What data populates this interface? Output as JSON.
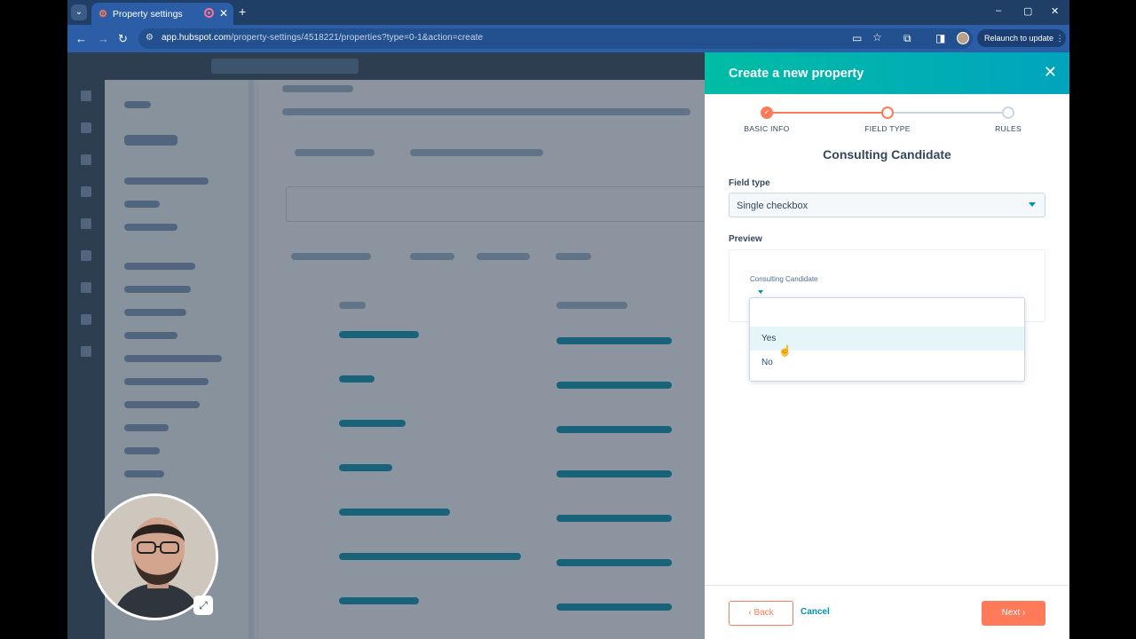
{
  "browser": {
    "tab_title": "Property settings",
    "tab_close": "✕",
    "new_tab": "+",
    "url_host": "app.hubspot.com",
    "url_path": "/property-settings/4518221/properties?type=0-1&action=create",
    "relaunch_label": "Relaunch to update",
    "window_controls": [
      "–",
      "▢",
      "✕"
    ]
  },
  "panel": {
    "title": "Create a new property",
    "close_glyph": "✕",
    "steps": [
      {
        "label": "BASIC INFO",
        "state": "complete"
      },
      {
        "label": "FIELD TYPE",
        "state": "active"
      },
      {
        "label": "RULES",
        "state": "pending"
      }
    ],
    "property_name": "Consulting Candidate",
    "field_type_label": "Field type",
    "field_type_value": "Single checkbox",
    "preview_label": "Preview",
    "preview_field_label": "Consulting Candidate",
    "dropdown_options": [
      {
        "label": "",
        "state": "normal"
      },
      {
        "label": "Yes",
        "state": "hover"
      },
      {
        "label": "No",
        "state": "normal"
      }
    ],
    "back_label": "Back",
    "cancel_label": "Cancel",
    "next_label": "Next"
  },
  "colors": {
    "header_gradient_start": "#00bda5",
    "header_gradient_end": "#00a4bd",
    "accent_orange": "#ff7a59",
    "link_teal": "#0091ae",
    "text_dark": "#33475b"
  },
  "icons": {
    "close": "close-icon",
    "caret": "caret-down-icon",
    "check": "check-icon",
    "cursor": "hand-pointer-icon",
    "expand": "expand-icon"
  }
}
